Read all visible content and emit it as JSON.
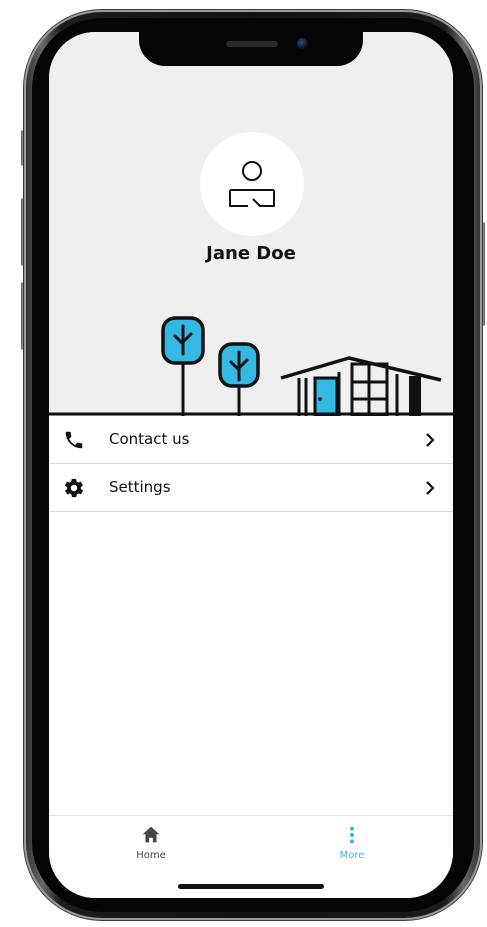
{
  "profile": {
    "name": "Jane Doe",
    "avatar_icon": "user-placeholder-icon"
  },
  "menu": {
    "items": [
      {
        "label": "Contact us",
        "icon": "phone-icon",
        "trailing_icon": "chevron-right-icon"
      },
      {
        "label": "Settings",
        "icon": "gear-icon",
        "trailing_icon": "chevron-right-icon"
      }
    ]
  },
  "tabbar": {
    "tabs": [
      {
        "label": "Home",
        "icon": "home-icon",
        "active": false
      },
      {
        "label": "More",
        "icon": "more-vertical-icon",
        "active": true
      }
    ]
  },
  "colors": {
    "accent": "#34b9e2",
    "header_background": "#efefef",
    "text": "#111111",
    "tab_inactive": "#444444",
    "divider": "#dcdcdc"
  }
}
